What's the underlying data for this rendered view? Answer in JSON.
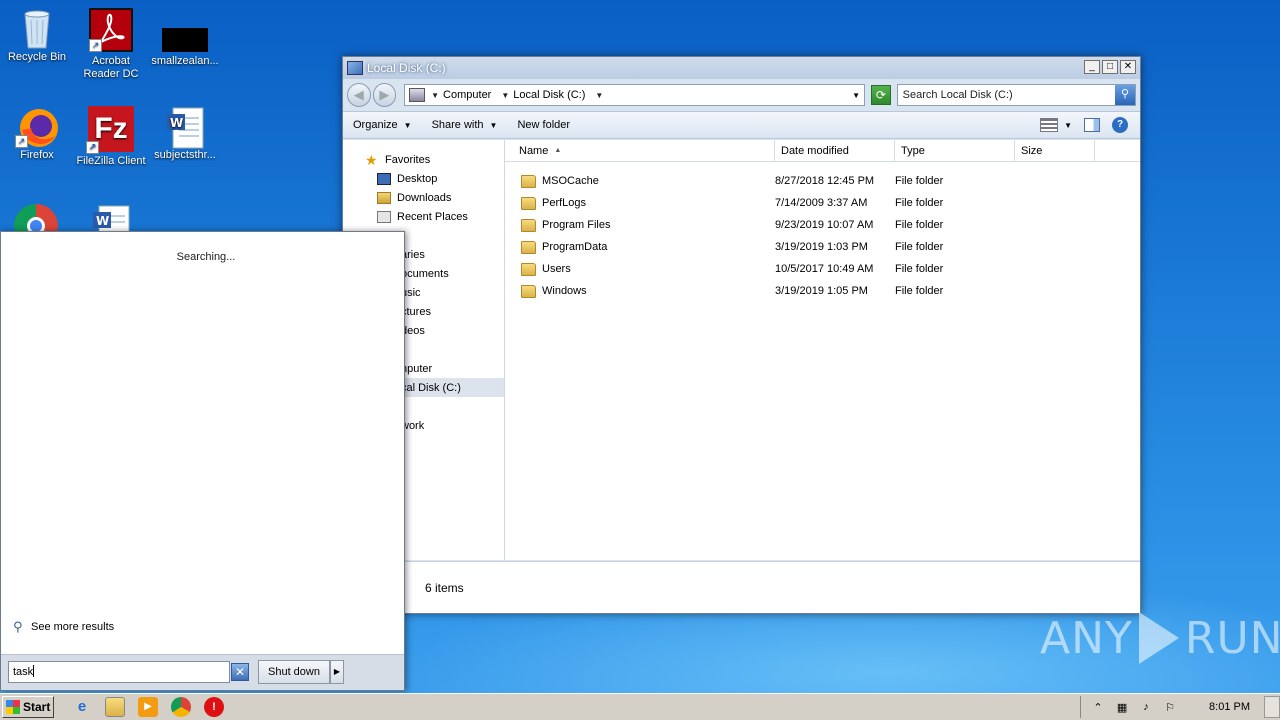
{
  "desktop": {
    "icons": [
      {
        "label": "Recycle Bin",
        "icon": "recycle-bin-icon"
      },
      {
        "label": "Acrobat Reader DC",
        "icon": "acrobat-icon"
      },
      {
        "label": "smallzealan...",
        "icon": "black-file-icon"
      },
      {
        "label": "Firefox",
        "icon": "firefox-icon"
      },
      {
        "label": "FileZilla Client",
        "icon": "filezilla-icon"
      },
      {
        "label": "subjectsthr...",
        "icon": "word-doc-icon"
      }
    ]
  },
  "explorer": {
    "title": "Local Disk (C:)",
    "controls": {
      "minimize": "_",
      "maximize": "□",
      "close": "✕"
    },
    "address": {
      "crumbs": [
        "Computer",
        "Local Disk (C:)"
      ]
    },
    "search_placeholder": "Search Local Disk (C:)",
    "toolbar": {
      "organize": "Organize",
      "share_with": "Share with",
      "new_folder": "New folder"
    },
    "nav": {
      "favorites": "Favorites",
      "desktop": "Desktop",
      "downloads": "Downloads",
      "recent_places": "Recent Places",
      "libraries": "aries",
      "documents": "ocuments",
      "music": "usic",
      "pictures": "ctures",
      "videos": "deos",
      "computer": "nputer",
      "local_disk": "cal Disk (C:)",
      "network": "work"
    },
    "columns": {
      "name": "Name",
      "date_modified": "Date modified",
      "type": "Type",
      "size": "Size"
    },
    "files": [
      {
        "name": "MSOCache",
        "date": "8/27/2018 12:45 PM",
        "type": "File folder"
      },
      {
        "name": "PerfLogs",
        "date": "7/14/2009 3:37 AM",
        "type": "File folder"
      },
      {
        "name": "Program Files",
        "date": "9/23/2019 10:07 AM",
        "type": "File folder"
      },
      {
        "name": "ProgramData",
        "date": "3/19/2019 1:03 PM",
        "type": "File folder"
      },
      {
        "name": "Users",
        "date": "10/5/2017 10:49 AM",
        "type": "File folder"
      },
      {
        "name": "Windows",
        "date": "3/19/2019 1:05 PM",
        "type": "File folder"
      }
    ],
    "status": "6 items"
  },
  "start_menu": {
    "searching": "Searching...",
    "see_more": "See more results",
    "search_value": "task",
    "shutdown": "Shut down"
  },
  "taskbar": {
    "start": "Start",
    "clock": "8:01 PM"
  },
  "watermark": {
    "left": "ANY",
    "right": "RUN"
  }
}
